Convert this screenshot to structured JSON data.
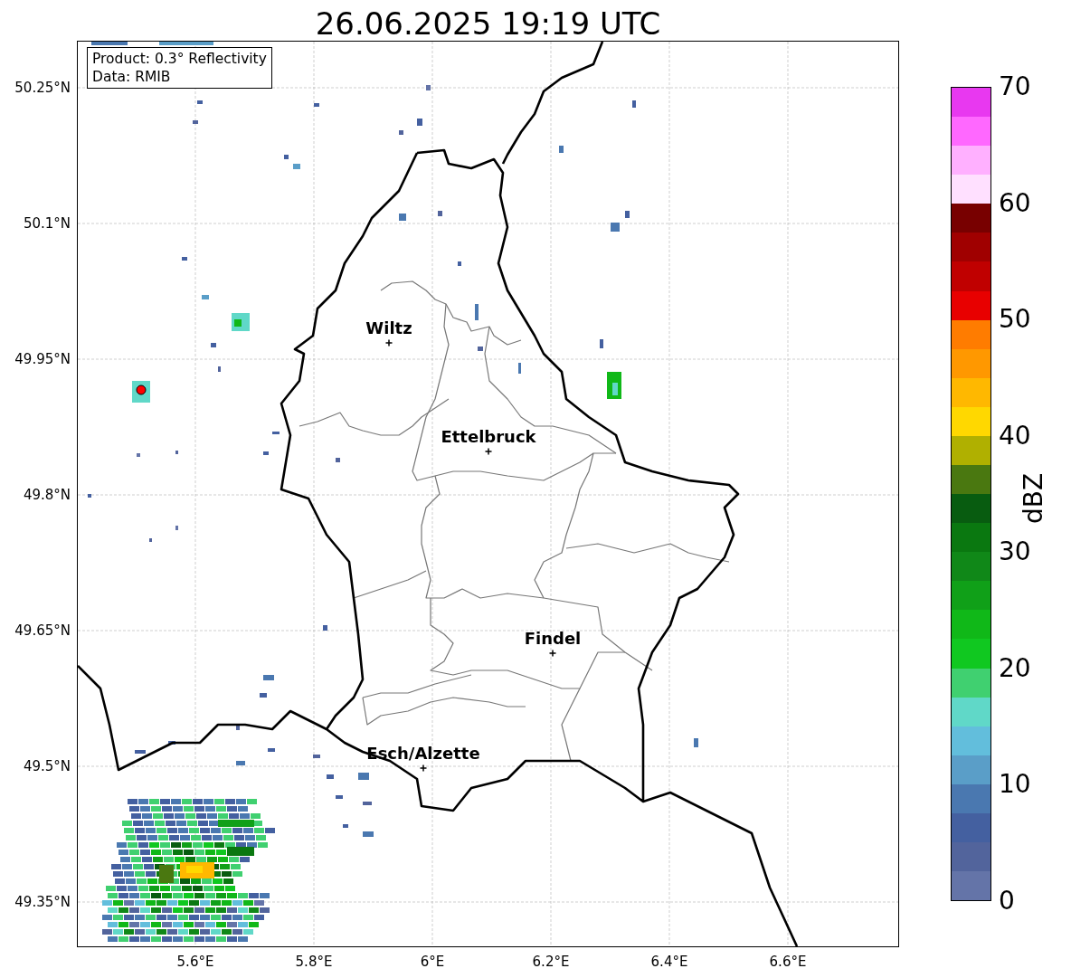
{
  "figure": {
    "title": "26.06.2025 19:19 UTC"
  },
  "info_box": {
    "lines": [
      "Product: 0.3° Reflectivity",
      "Data: RMIB"
    ]
  },
  "map": {
    "x_tick_labels": [
      "5.6°E",
      "5.8°E",
      "6°E",
      "6.2°E",
      "6.4°E",
      "6.6°E"
    ],
    "y_tick_labels": [
      "50.25°N",
      "50.1°N",
      "49.95°N",
      "49.8°N",
      "49.65°N",
      "49.5°N",
      "49.35°N"
    ],
    "cities": [
      {
        "name": "Wiltz"
      },
      {
        "name": "Ettelbruck"
      },
      {
        "name": "Findel"
      },
      {
        "name": "Esch/Alzette"
      }
    ]
  },
  "colorbar": {
    "label": "dBZ",
    "ticks": [
      "70",
      "60",
      "50",
      "40",
      "30",
      "20",
      "10",
      "0"
    ],
    "bands": [
      {
        "color": "#e838f0"
      },
      {
        "color": "#ff68ff"
      },
      {
        "color": "#ffb0ff"
      },
      {
        "color": "#ffe0ff"
      },
      {
        "color": "#780000"
      },
      {
        "color": "#a00000"
      },
      {
        "color": "#c00000"
      },
      {
        "color": "#e80000"
      },
      {
        "color": "#ff7c00"
      },
      {
        "color": "#ff9800"
      },
      {
        "color": "#ffb800"
      },
      {
        "color": "#ffd800"
      },
      {
        "color": "#b0b000"
      },
      {
        "color": "#4a7810"
      },
      {
        "color": "#085c10"
      },
      {
        "color": "#0a7810"
      },
      {
        "color": "#108818"
      },
      {
        "color": "#10a018"
      },
      {
        "color": "#10b818"
      },
      {
        "color": "#10c820"
      },
      {
        "color": "#40d070"
      },
      {
        "color": "#60d8c8"
      },
      {
        "color": "#62bedc"
      },
      {
        "color": "#5a9ec8"
      },
      {
        "color": "#4a78b0"
      },
      {
        "color": "#4460a0"
      },
      {
        "color": "#52649c"
      },
      {
        "color": "#6474a8"
      }
    ]
  }
}
